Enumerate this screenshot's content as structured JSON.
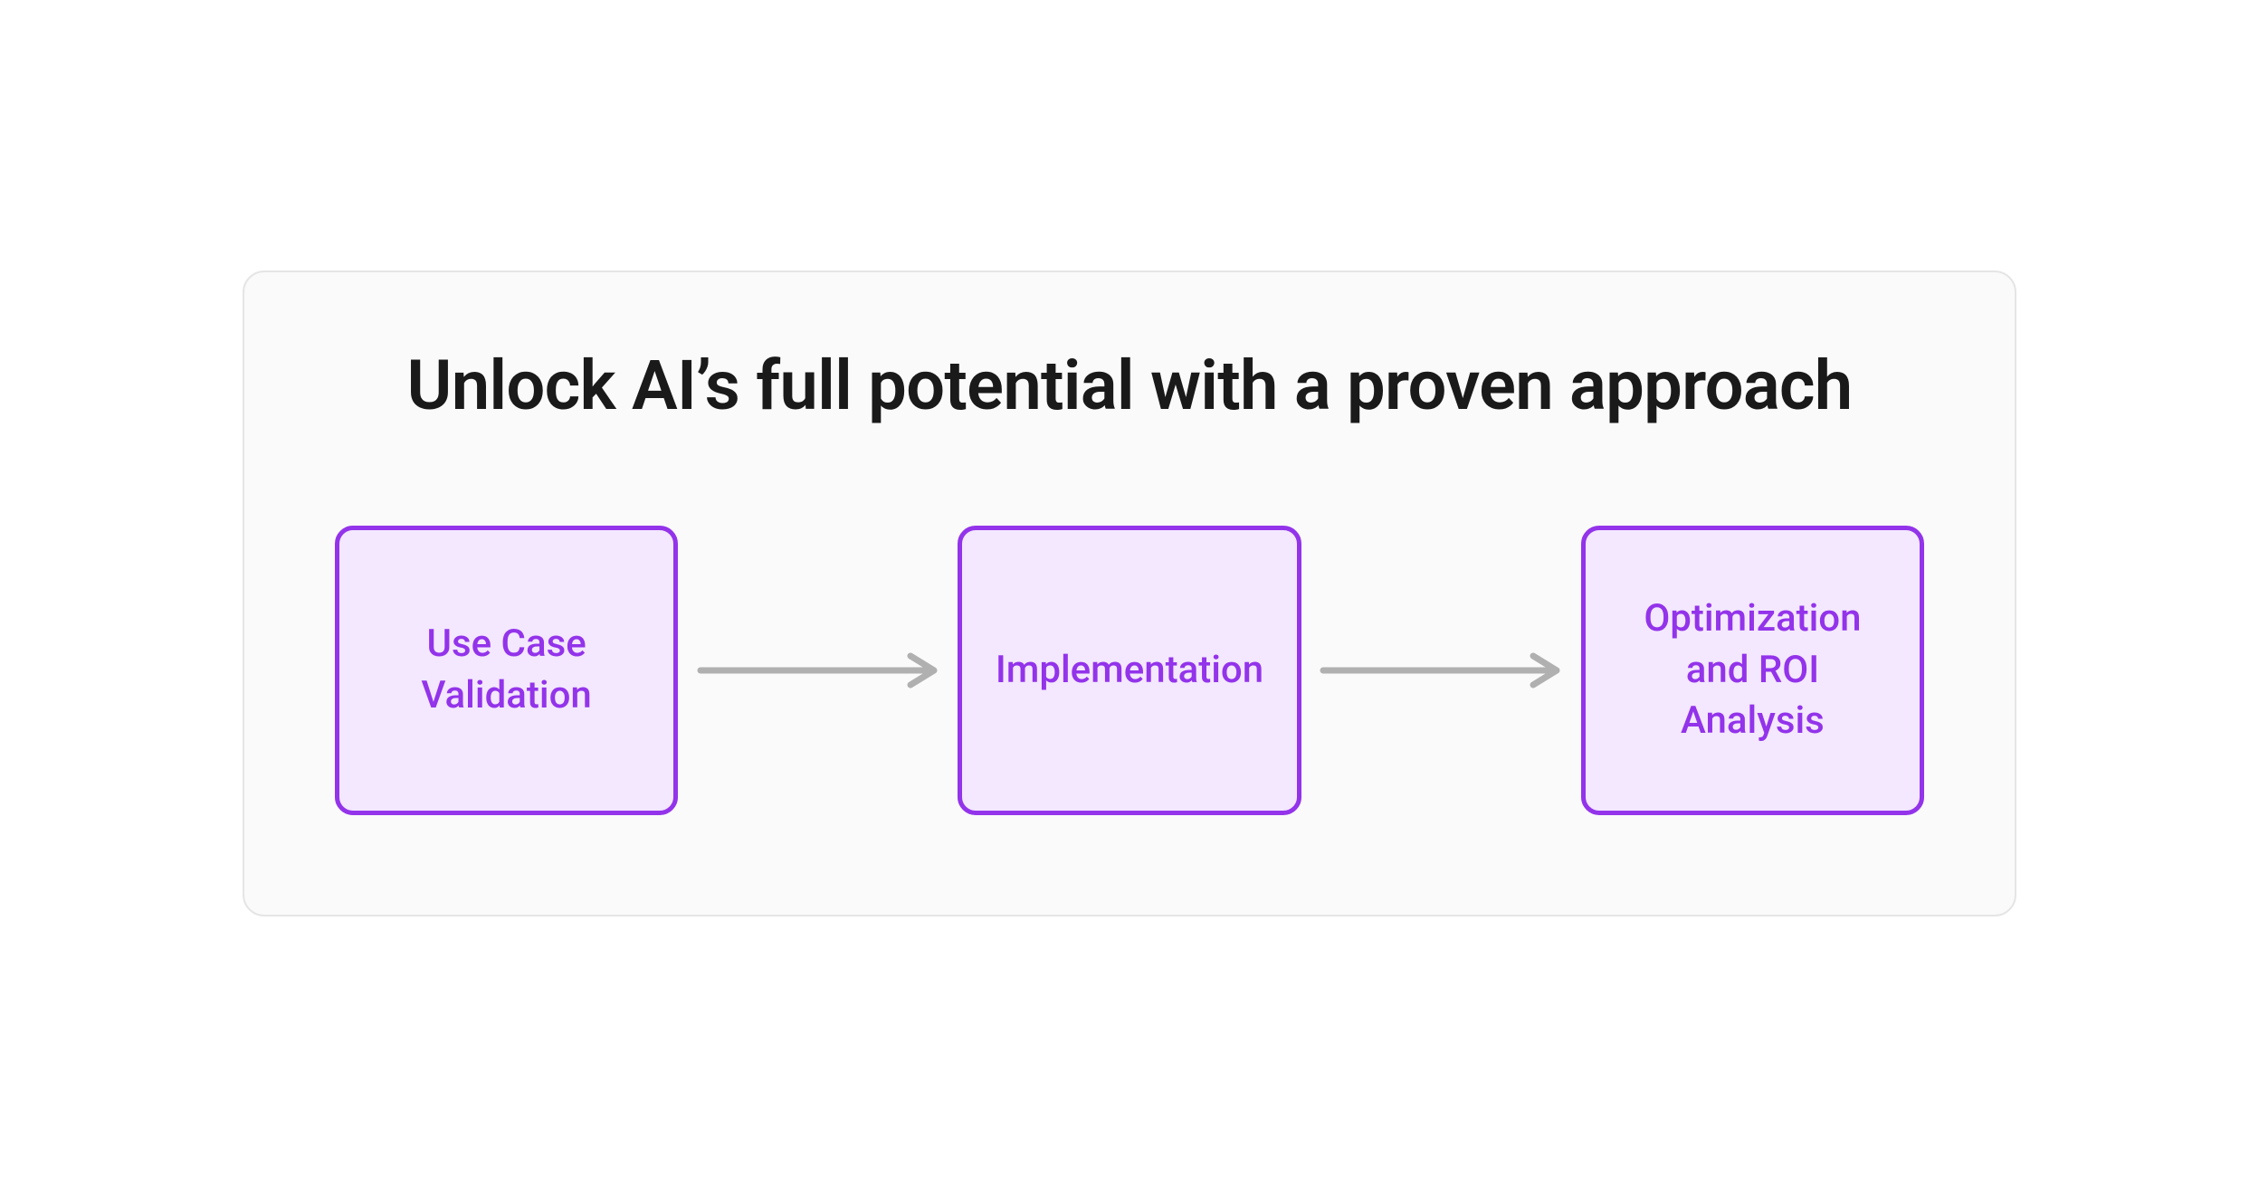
{
  "title": "Unlock AI’s full potential with a proven approach",
  "steps": {
    "0": {
      "label": "Use Case Validation"
    },
    "1": {
      "label": "Implementation"
    },
    "2": {
      "label": "Optimization and ROI Analysis"
    }
  },
  "colors": {
    "accent": "#9333ea",
    "box_fill": "#f3e8ff",
    "arrow": "#b0b0b0",
    "panel_bg": "#fafafa",
    "panel_border": "#e5e5e5"
  }
}
